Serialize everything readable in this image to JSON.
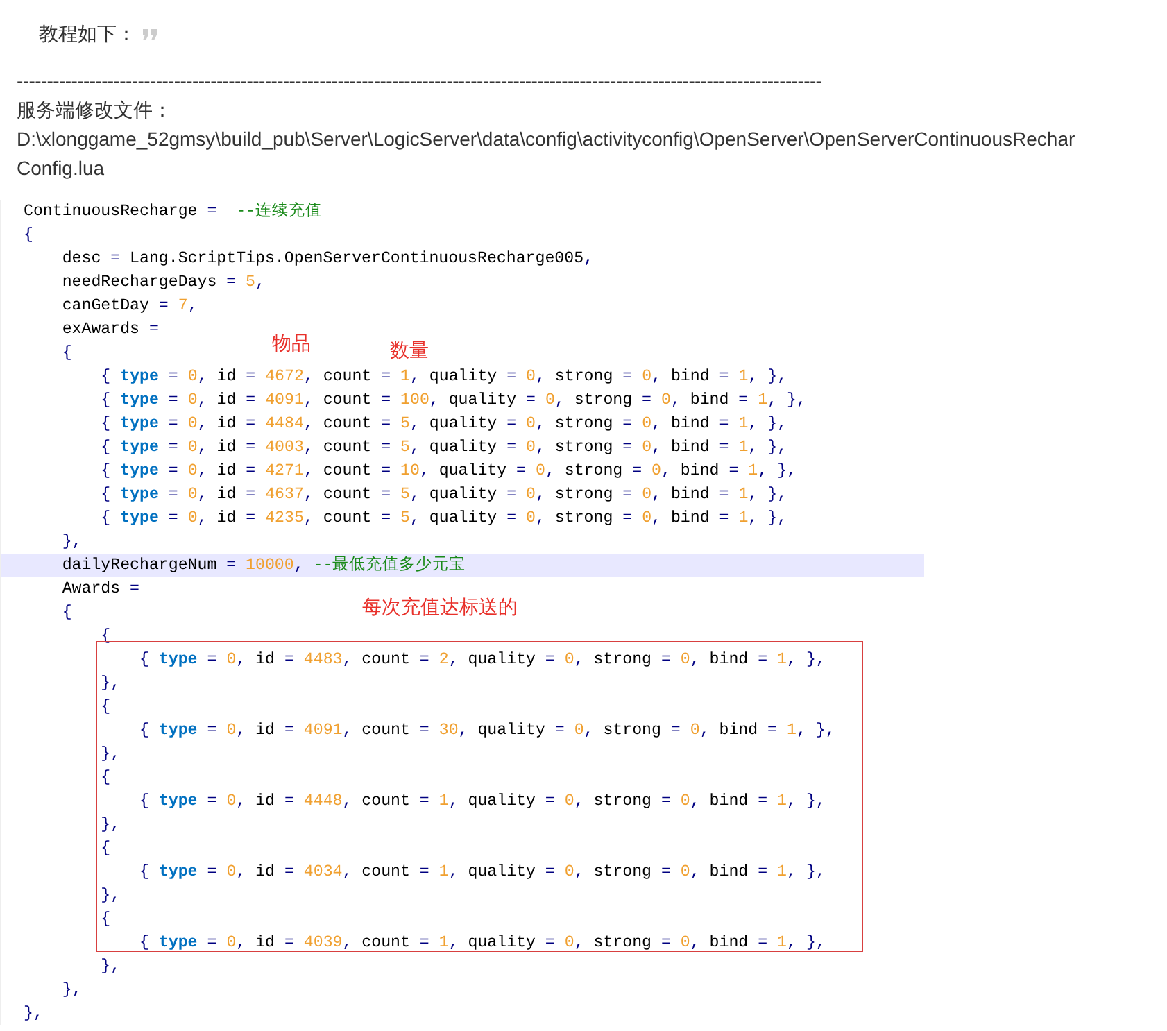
{
  "intro": "教程如下：",
  "separator": "-------------------------------------------------------------------------------------------------------------------------------------",
  "file_label": "服务端修改文件：",
  "file_path": "D:\\xlonggame_52gmsy\\build_pub\\Server\\LogicServer\\data\\config\\activityconfig\\OpenServer\\OpenServerContinuousRechar",
  "file_name": "Config.lua",
  "code": {
    "lines": [
      {
        "text": "ContinuousRecharge =  --连续充值",
        "selected": false
      },
      {
        "text": "{",
        "selected": false
      },
      {
        "text": "    desc = Lang.ScriptTips.OpenServerContinuousRecharge005,",
        "selected": false
      },
      {
        "text": "    needRechargeDays = 5,",
        "selected": false
      },
      {
        "text": "    canGetDay = 7,",
        "selected": false
      },
      {
        "text": "    exAwards =",
        "selected": false
      },
      {
        "text": "    {",
        "selected": false
      },
      {
        "text": "        { type = 0, id = 4672, count = 1, quality = 0, strong = 0, bind = 1, },",
        "selected": false
      },
      {
        "text": "        { type = 0, id = 4091, count = 100, quality = 0, strong = 0, bind = 1, },",
        "selected": false
      },
      {
        "text": "        { type = 0, id = 4484, count = 5, quality = 0, strong = 0, bind = 1, },",
        "selected": false
      },
      {
        "text": "        { type = 0, id = 4003, count = 5, quality = 0, strong = 0, bind = 1, },",
        "selected": false
      },
      {
        "text": "        { type = 0, id = 4271, count = 10, quality = 0, strong = 0, bind = 1, },",
        "selected": false
      },
      {
        "text": "        { type = 0, id = 4637, count = 5, quality = 0, strong = 0, bind = 1, },",
        "selected": false
      },
      {
        "text": "        { type = 0, id = 4235, count = 5, quality = 0, strong = 0, bind = 1, },",
        "selected": false
      },
      {
        "text": "    },",
        "selected": false
      },
      {
        "text": "    dailyRechargeNum = 10000, --最低充值多少元宝",
        "selected": true
      },
      {
        "text": "    Awards =",
        "selected": false
      },
      {
        "text": "    {",
        "selected": false
      },
      {
        "text": "        {",
        "selected": false
      },
      {
        "text": "            { type = 0, id = 4483, count = 2, quality = 0, strong = 0, bind = 1, },",
        "selected": false
      },
      {
        "text": "        },",
        "selected": false
      },
      {
        "text": "        {",
        "selected": false
      },
      {
        "text": "            { type = 0, id = 4091, count = 30, quality = 0, strong = 0, bind = 1, },",
        "selected": false
      },
      {
        "text": "        },",
        "selected": false
      },
      {
        "text": "        {",
        "selected": false
      },
      {
        "text": "            { type = 0, id = 4448, count = 1, quality = 0, strong = 0, bind = 1, },",
        "selected": false
      },
      {
        "text": "        },",
        "selected": false
      },
      {
        "text": "        {",
        "selected": false
      },
      {
        "text": "            { type = 0, id = 4034, count = 1, quality = 0, strong = 0, bind = 1, },",
        "selected": false
      },
      {
        "text": "        },",
        "selected": false
      },
      {
        "text": "        {",
        "selected": false
      },
      {
        "text": "            { type = 0, id = 4039, count = 1, quality = 0, strong = 0, bind = 1, },",
        "selected": false
      },
      {
        "text": "        },",
        "selected": false
      },
      {
        "text": "    },",
        "selected": false
      },
      {
        "text": "},",
        "selected": false
      }
    ],
    "annotations": [
      {
        "text": "物品",
        "kind": "label"
      },
      {
        "text": "数量",
        "kind": "label"
      },
      {
        "text": "每次充值达标送的",
        "kind": "label"
      }
    ]
  }
}
